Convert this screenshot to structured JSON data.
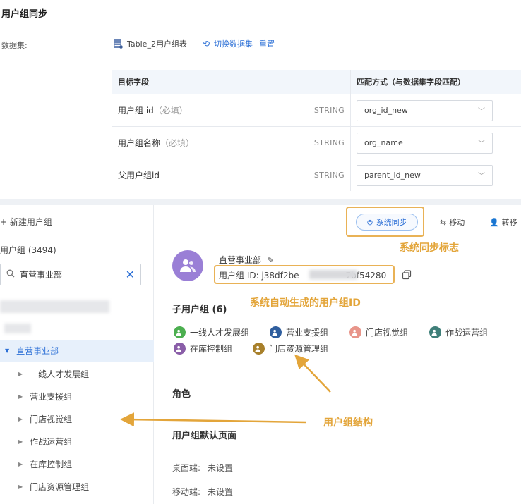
{
  "sync": {
    "title": "用户组同步",
    "dataset_label": "数据集:",
    "dataset_name": "Table_2用户组表",
    "switch_dataset": "切换数据集",
    "reset": "重置"
  },
  "mapping": {
    "headers": {
      "field": "目标字段",
      "match": "匹配方式（与数据集字段匹配）"
    },
    "rows": [
      {
        "field": "用户组 id",
        "required": "（必填）",
        "type": "STRING",
        "match": "org_id_new"
      },
      {
        "field": "用户组名称",
        "required": "（必填）",
        "type": "STRING",
        "match": "org_name"
      },
      {
        "field": "父用户组id",
        "required": "",
        "type": "STRING",
        "match": "parent_id_new"
      }
    ]
  },
  "left": {
    "new_group": "+  新建用户组",
    "group_count": "用户组 (3494)",
    "search_value": "直营事业部",
    "tree": {
      "selected": "直营事业部",
      "children": [
        "一线人才发展组",
        "营业支援组",
        "门店视觉组",
        "作战运营组",
        "在库控制组",
        "门店资源管理组"
      ]
    }
  },
  "toolbar": {
    "sync_label": "系统同步",
    "move_label": "移动",
    "transfer_label": "转移"
  },
  "detail": {
    "group_name": "直营事业部",
    "id_label": "用户组 ID: j38df2be",
    "id_suffix": "7bf54280",
    "subgroups_title": "子用户组 (6)",
    "subgroups": [
      {
        "label": "一线人才发展组",
        "color": "#4caf50"
      },
      {
        "label": "营业支援组",
        "color": "#2f5e9e"
      },
      {
        "label": "门店视觉组",
        "color": "#e8958a"
      },
      {
        "label": "作战运营组",
        "color": "#3f7f79"
      },
      {
        "label": "在库控制组",
        "color": "#8a5ea8"
      },
      {
        "label": "门店资源管理组",
        "color": "#a8802b"
      }
    ],
    "role_title": "角色",
    "default_page_title": "用户组默认页面",
    "desktop_label": "桌面端:",
    "desktop_value": "未设置",
    "mobile_label": "移动端:",
    "mobile_value": "未设置"
  },
  "annotations": {
    "sync_mark": "系统同步标志",
    "auto_id": "系统自动生成的用户组ID",
    "structure": "用户组结构"
  },
  "colors": {
    "accent": "#2b6fd6",
    "annotation": "#e3a53a",
    "avatar": "#9a7fd6"
  }
}
